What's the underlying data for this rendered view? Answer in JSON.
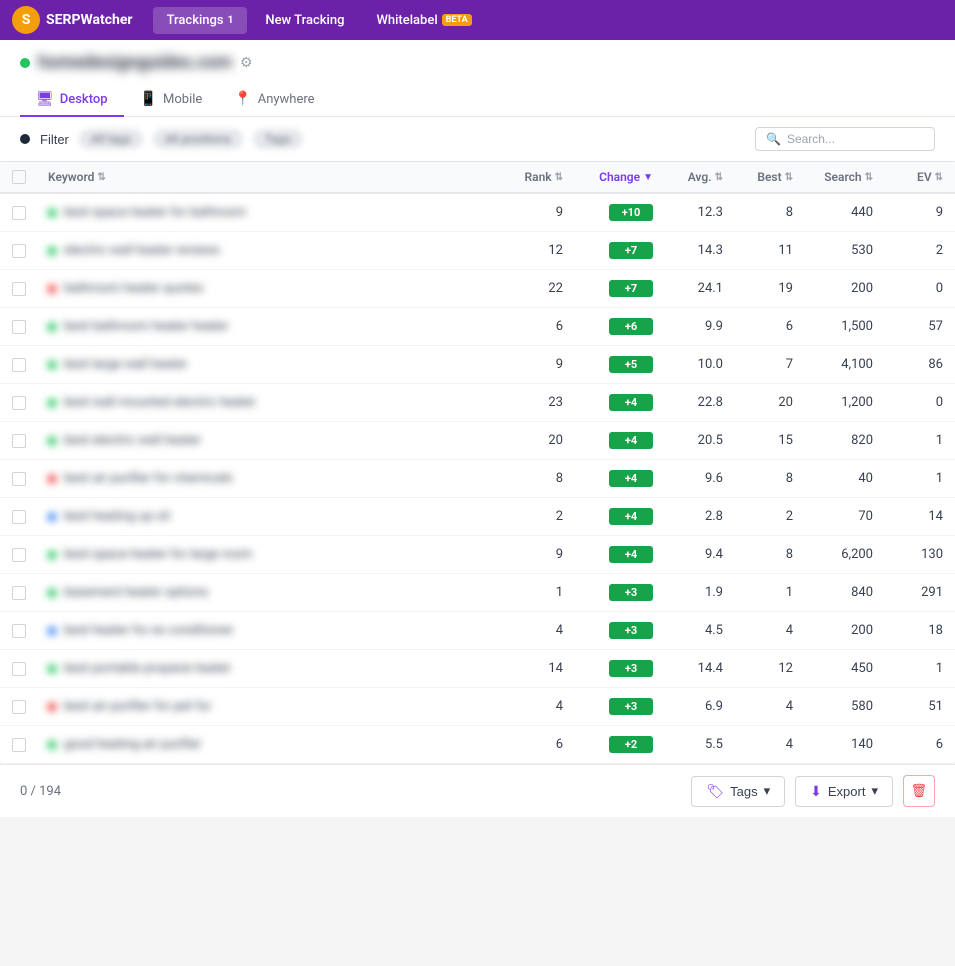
{
  "nav": {
    "logo_text": "SERPWatcher",
    "items": [
      {
        "id": "trackings",
        "label": "Trackings",
        "badge": "1",
        "active": true
      },
      {
        "id": "new-tracking",
        "label": "New Tracking",
        "active": false
      },
      {
        "id": "whitelabel",
        "label": "Whitelabel",
        "badge_text": "BETA",
        "active": false
      }
    ]
  },
  "domain": {
    "name": "homedesignguides.com",
    "active": true
  },
  "device_tabs": [
    {
      "id": "desktop",
      "label": "Desktop",
      "icon": "🖥",
      "active": true
    },
    {
      "id": "mobile",
      "label": "Mobile",
      "icon": "📱",
      "active": false
    },
    {
      "id": "anywhere",
      "label": "Anywhere",
      "icon": "📍",
      "active": false
    }
  ],
  "filter": {
    "label": "Filter",
    "tags": [
      "All tags",
      "All positions",
      "Tags"
    ],
    "search_placeholder": "Search..."
  },
  "table": {
    "columns": [
      {
        "id": "checkbox",
        "label": ""
      },
      {
        "id": "keyword",
        "label": "Keyword"
      },
      {
        "id": "rank",
        "label": "Rank"
      },
      {
        "id": "change",
        "label": "Change"
      },
      {
        "id": "avg",
        "label": "Avg."
      },
      {
        "id": "best",
        "label": "Best"
      },
      {
        "id": "search",
        "label": "Search"
      },
      {
        "id": "ev",
        "label": "EV"
      }
    ],
    "rows": [
      {
        "keyword": "best space heater for bathroom",
        "dot_color": "green",
        "rank": 9,
        "change": "+10",
        "avg": "12.3",
        "best": 8,
        "search": "440",
        "ev": 9
      },
      {
        "keyword": "electric wall heater reviews",
        "dot_color": "green",
        "rank": 12,
        "change": "+7",
        "avg": "14.3",
        "best": 11,
        "search": "530",
        "ev": 2
      },
      {
        "keyword": "bathroom heater quotes",
        "dot_color": "red",
        "rank": 22,
        "change": "+7",
        "avg": "24.1",
        "best": 19,
        "search": "200",
        "ev": 0
      },
      {
        "keyword": "best bathroom heater heater",
        "dot_color": "green",
        "rank": 6,
        "change": "+6",
        "avg": "9.9",
        "best": 6,
        "search": "1,500",
        "ev": 57
      },
      {
        "keyword": "best large wall heater",
        "dot_color": "green",
        "rank": 9,
        "change": "+5",
        "avg": "10.0",
        "best": 7,
        "search": "4,100",
        "ev": 86
      },
      {
        "keyword": "best wall mounted electric heater",
        "dot_color": "green",
        "rank": 23,
        "change": "+4",
        "avg": "22.8",
        "best": 20,
        "search": "1,200",
        "ev": 0
      },
      {
        "keyword": "best electric wall heater",
        "dot_color": "green",
        "rank": 20,
        "change": "+4",
        "avg": "20.5",
        "best": 15,
        "search": "820",
        "ev": 1
      },
      {
        "keyword": "best air purifier for chemicals",
        "dot_color": "red",
        "rank": 8,
        "change": "+4",
        "avg": "9.6",
        "best": 8,
        "search": "40",
        "ev": 1
      },
      {
        "keyword": "best heating up oil",
        "dot_color": "blue",
        "rank": 2,
        "change": "+4",
        "avg": "2.8",
        "best": 2,
        "search": "70",
        "ev": 14
      },
      {
        "keyword": "best space heater for large room",
        "dot_color": "green",
        "rank": 9,
        "change": "+4",
        "avg": "9.4",
        "best": 8,
        "search": "6,200",
        "ev": 130
      },
      {
        "keyword": "basement heater options",
        "dot_color": "green",
        "rank": 1,
        "change": "+3",
        "avg": "1.9",
        "best": 1,
        "search": "840",
        "ev": 291
      },
      {
        "keyword": "best heater for ex conditioner",
        "dot_color": "blue",
        "rank": 4,
        "change": "+3",
        "avg": "4.5",
        "best": 4,
        "search": "200",
        "ev": 18
      },
      {
        "keyword": "best portable propane heater",
        "dot_color": "green",
        "rank": 14,
        "change": "+3",
        "avg": "14.4",
        "best": 12,
        "search": "450",
        "ev": 1
      },
      {
        "keyword": "best air purifier for pet fur",
        "dot_color": "red",
        "rank": 4,
        "change": "+3",
        "avg": "6.9",
        "best": 4,
        "search": "580",
        "ev": 51
      },
      {
        "keyword": "good heating air purifier",
        "dot_color": "green",
        "rank": 6,
        "change": "+2",
        "avg": "5.5",
        "best": 4,
        "search": "140",
        "ev": 6
      }
    ]
  },
  "footer": {
    "count": "0 / 194",
    "tags_label": "Tags",
    "export_label": "Export",
    "chevron": "▾"
  }
}
